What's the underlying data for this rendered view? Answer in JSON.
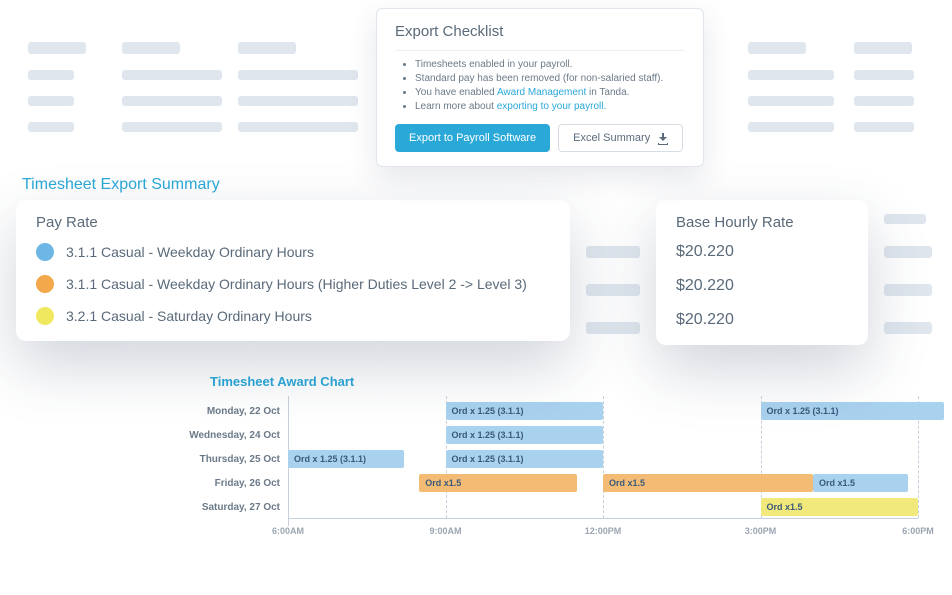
{
  "checklist": {
    "title": "Export Checklist",
    "items": [
      {
        "text": "Timesheets enabled in your payroll."
      },
      {
        "text_before": "Standard pay has been removed (for non-salaried staff)."
      },
      {
        "text_before": "You have enabled ",
        "link": "Award Management",
        "text_after": " in Tanda."
      },
      {
        "text_before": "Learn more about ",
        "link": "exporting to your payroll.",
        "text_after": ""
      }
    ],
    "primary_btn": "Export to Payroll Software",
    "secondary_btn": "Excel Summary"
  },
  "summary": {
    "title": "Timesheet Export Summary",
    "payrate_header": "Pay Rate",
    "baserate_header": "Base Hourly Rate",
    "rows": [
      {
        "color": "blue",
        "label": "3.1.1 Casual - Weekday Ordinary Hours",
        "rate": "$20.220"
      },
      {
        "color": "orange",
        "label": "3.1.1 Casual - Weekday Ordinary Hours (Higher Duties Level 2 -> Level 3)",
        "rate": "$20.220"
      },
      {
        "color": "yellow",
        "label": "3.2.1 Casual - Saturday Ordinary Hours",
        "rate": "$20.220"
      }
    ]
  },
  "chart_data": {
    "type": "gantt",
    "title": "Timesheet Award Chart",
    "x_ticks": [
      "6:00AM",
      "9:00AM",
      "12:00PM",
      "3:00PM",
      "6:00PM"
    ],
    "x_range_hours": [
      6,
      18
    ],
    "rows": [
      {
        "label": "Monday, 22 Oct",
        "bars": [
          {
            "start": 9,
            "end": 12,
            "text": "Ord x 1.25 (3.1.1)",
            "color": "blue"
          },
          {
            "start": 15,
            "end": 18.5,
            "text": "Ord x 1.25 (3.1.1)",
            "color": "blue"
          }
        ]
      },
      {
        "label": "Wednesday, 24 Oct",
        "bars": [
          {
            "start": 9,
            "end": 12,
            "text": "Ord x 1.25 (3.1.1)",
            "color": "blue"
          }
        ]
      },
      {
        "label": "Thursday, 25 Oct",
        "bars": [
          {
            "start": 6,
            "end": 8.2,
            "text": "Ord x 1.25 (3.1.1)",
            "color": "blue"
          },
          {
            "start": 9,
            "end": 12,
            "text": "Ord x 1.25 (3.1.1)",
            "color": "blue"
          }
        ]
      },
      {
        "label": "Friday, 26 Oct",
        "bars": [
          {
            "start": 8.5,
            "end": 11.5,
            "text": "Ord x1.5",
            "color": "orange"
          },
          {
            "start": 12,
            "end": 16,
            "text": "Ord x1.5",
            "color": "orange"
          },
          {
            "start": 16,
            "end": 17.8,
            "text": "Ord x1.5",
            "color": "blue"
          }
        ]
      },
      {
        "label": "Saturday, 27 Oct",
        "bars": [
          {
            "start": 15,
            "end": 18,
            "text": "Ord x1.5",
            "color": "yellow"
          }
        ]
      }
    ]
  }
}
